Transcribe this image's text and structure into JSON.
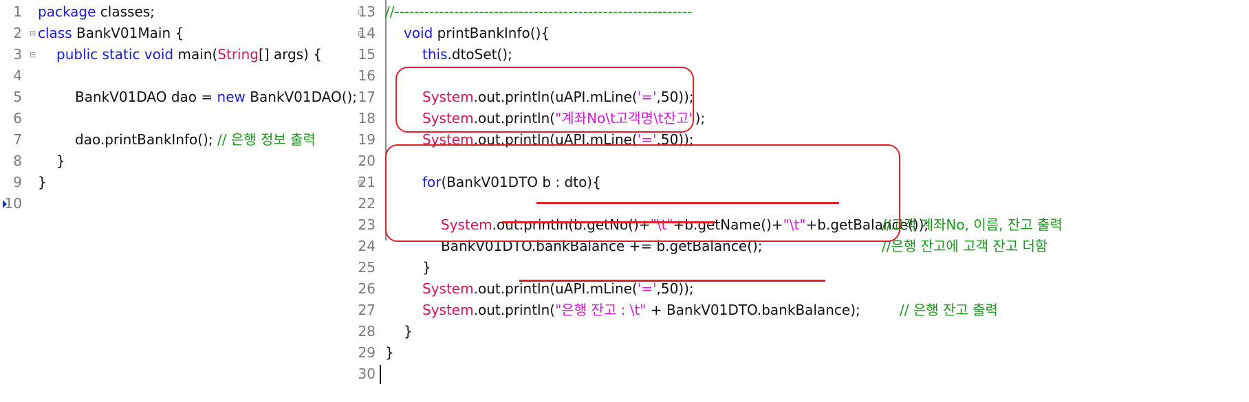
{
  "left_editor": {
    "lines": [
      {
        "num": "1",
        "fold": "",
        "indent": 0,
        "tokens": [
          {
            "t": "package",
            "c": "kw"
          },
          {
            "t": " classes;",
            "c": "plain"
          }
        ]
      },
      {
        "num": "2",
        "fold": "⊟",
        "indent": 0,
        "tokens": [
          {
            "t": "class",
            "c": "kw"
          },
          {
            "t": " BankV01Main {",
            "c": "plain"
          }
        ]
      },
      {
        "num": "3",
        "fold": "⊟",
        "indent": 1,
        "tokens": [
          {
            "t": "public static void",
            "c": "kw"
          },
          {
            "t": " main(",
            "c": "plain"
          },
          {
            "t": "String",
            "c": "ty"
          },
          {
            "t": "[] args) {",
            "c": "plain"
          }
        ]
      },
      {
        "num": "4",
        "fold": "",
        "indent": 0,
        "tokens": []
      },
      {
        "num": "5",
        "fold": "",
        "indent": 2,
        "tokens": [
          {
            "t": "BankV01DAO dao = ",
            "c": "plain"
          },
          {
            "t": "new",
            "c": "kw"
          },
          {
            "t": " BankV01DAO();",
            "c": "plain"
          }
        ]
      },
      {
        "num": "6",
        "fold": "",
        "indent": 0,
        "tokens": []
      },
      {
        "num": "7",
        "fold": "",
        "indent": 2,
        "tokens": [
          {
            "t": "dao.printBankInfo(); ",
            "c": "plain"
          },
          {
            "t": "// 은행 정보 출력",
            "c": "cm"
          }
        ]
      },
      {
        "num": "8",
        "fold": "",
        "indent": 1,
        "tokens": [
          {
            "t": "}",
            "c": "plain"
          }
        ]
      },
      {
        "num": "9",
        "fold": "",
        "indent": 0,
        "tokens": [
          {
            "t": "}",
            "c": "plain"
          }
        ]
      },
      {
        "num": "10",
        "fold": "",
        "indent": 0,
        "tokens": [],
        "bookmark": true
      }
    ]
  },
  "right_editor": {
    "lines": [
      {
        "num": "13",
        "fold": "⊟",
        "indent": 0,
        "tokens": [
          {
            "t": "//------------------------------------------------------------",
            "c": "cm"
          }
        ]
      },
      {
        "num": "14",
        "fold": "⊟",
        "indent": 1,
        "tokens": [
          {
            "t": "void",
            "c": "kw"
          },
          {
            "t": " printBankInfo(){",
            "c": "plain"
          }
        ]
      },
      {
        "num": "15",
        "fold": "",
        "indent": 2,
        "tokens": [
          {
            "t": "this",
            "c": "kw"
          },
          {
            "t": ".dtoSet();",
            "c": "plain"
          }
        ]
      },
      {
        "num": "16",
        "fold": "",
        "indent": 0,
        "tokens": []
      },
      {
        "num": "17",
        "fold": "",
        "indent": 2,
        "tokens": [
          {
            "t": "System",
            "c": "ty"
          },
          {
            "t": ".out.println(uAPI.mLine(",
            "c": "plain"
          },
          {
            "t": "'='",
            "c": "str"
          },
          {
            "t": ",50));",
            "c": "plain"
          }
        ]
      },
      {
        "num": "18",
        "fold": "",
        "indent": 2,
        "tokens": [
          {
            "t": "System",
            "c": "ty"
          },
          {
            "t": ".out.println(",
            "c": "plain"
          },
          {
            "t": "\"계좌No\\t고객명\\t잔고\"",
            "c": "str"
          },
          {
            "t": ");",
            "c": "plain"
          }
        ]
      },
      {
        "num": "19",
        "fold": "",
        "indent": 2,
        "tokens": [
          {
            "t": "System",
            "c": "ty"
          },
          {
            "t": ".out.println(uAPI.mLine(",
            "c": "plain"
          },
          {
            "t": "'='",
            "c": "str"
          },
          {
            "t": ",50));",
            "c": "plain"
          }
        ]
      },
      {
        "num": "20",
        "fold": "",
        "indent": 0,
        "tokens": []
      },
      {
        "num": "21",
        "fold": "⊟",
        "indent": 2,
        "tokens": [
          {
            "t": "for",
            "c": "kw"
          },
          {
            "t": "(BankV01DTO b : dto){",
            "c": "plain"
          }
        ]
      },
      {
        "num": "22",
        "fold": "",
        "indent": 0,
        "tokens": []
      },
      {
        "num": "23",
        "fold": "",
        "indent": 3,
        "tokens": [
          {
            "t": "System",
            "c": "ty"
          },
          {
            "t": ".out.println(b.getNo()+",
            "c": "plain"
          },
          {
            "t": "\"\\t\"",
            "c": "str"
          },
          {
            "t": "+b.getName()+",
            "c": "plain"
          },
          {
            "t": "\"\\t\"",
            "c": "str"
          },
          {
            "t": "+b.getBalance());",
            "c": "plain"
          }
        ]
      },
      {
        "num": "24",
        "fold": "",
        "indent": 3,
        "tokens": [
          {
            "t": "BankV01DTO.bankBalance += b.getBalance();",
            "c": "plain"
          }
        ]
      },
      {
        "num": "25",
        "fold": "",
        "indent": 2,
        "tokens": [
          {
            "t": "}",
            "c": "plain"
          }
        ]
      },
      {
        "num": "26",
        "fold": "",
        "indent": 2,
        "tokens": [
          {
            "t": "System",
            "c": "ty"
          },
          {
            "t": ".out.println(uAPI.mLine(",
            "c": "plain"
          },
          {
            "t": "'='",
            "c": "str"
          },
          {
            "t": ",50));",
            "c": "plain"
          }
        ]
      },
      {
        "num": "27",
        "fold": "",
        "indent": 2,
        "tokens": [
          {
            "t": "System",
            "c": "ty"
          },
          {
            "t": ".out.println(",
            "c": "plain"
          },
          {
            "t": "\"은행 잔고 : \\t\"",
            "c": "str"
          },
          {
            "t": " + BankV01DTO.bankBalance);",
            "c": "plain"
          }
        ]
      },
      {
        "num": "28",
        "fold": "",
        "indent": 1,
        "tokens": [
          {
            "t": "}",
            "c": "plain"
          }
        ]
      },
      {
        "num": "29",
        "fold": "",
        "indent": 0,
        "tokens": [
          {
            "t": "}",
            "c": "plain"
          }
        ]
      },
      {
        "num": "30",
        "fold": "",
        "indent": 0,
        "tokens": [],
        "caret": true
      }
    ],
    "side_comments": [
      {
        "line": "23",
        "text": "//고객 계좌No, 이름, 잔고 출력"
      },
      {
        "line": "24",
        "text": "//은행 잔고에 고객 잔고 더함"
      },
      {
        "line": "27",
        "text": "// 은행 잔고 출력"
      }
    ]
  },
  "colors": {
    "keyword": "#1a1ae0",
    "type": "#d4145a",
    "string": "#d41ad4",
    "comment": "#1a9a1a",
    "annotation": "#e0202a"
  },
  "icons": {
    "fold": "fold-minus-icon",
    "bookmark": "bookmark-arrow-icon"
  }
}
